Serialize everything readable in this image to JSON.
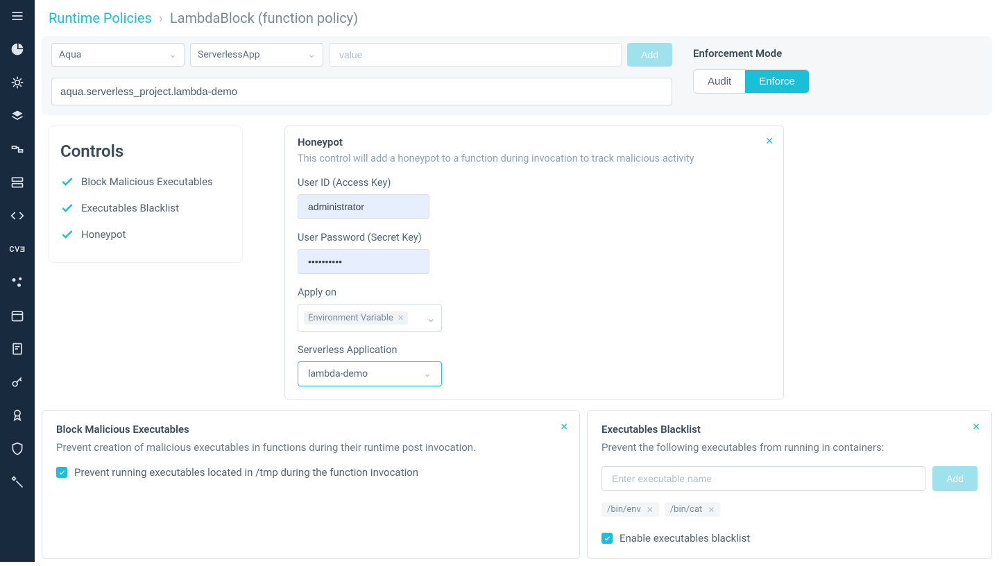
{
  "breadcrumb": {
    "root": "Runtime Policies",
    "current": "LambdaBlock (function policy)"
  },
  "topbar": {
    "select_namespace": "Aqua",
    "select_app": "ServerlessApp",
    "value_placeholder": "value",
    "add_label": "Add",
    "scope_value": "aqua.serverless_project.lambda-demo"
  },
  "enforcement": {
    "title": "Enforcement Mode",
    "options": [
      "Audit",
      "Enforce"
    ],
    "active": "Enforce"
  },
  "controls_panel": {
    "title": "Controls",
    "items": [
      "Block Malicious Executables",
      "Executables Blacklist",
      "Honeypot"
    ]
  },
  "honeypot": {
    "title": "Honeypot",
    "desc": "This control will add a honeypot to a function during invocation to track malicious activity",
    "user_id_label": "User ID (Access Key)",
    "user_id_value": "administrator",
    "password_label": "User Password (Secret Key)",
    "password_value": "••••••••••",
    "apply_on_label": "Apply on",
    "apply_on_chip": "Environment Variable",
    "app_label": "Serverless Application",
    "app_value": "lambda-demo"
  },
  "block_exec": {
    "title": "Block Malicious Executables",
    "desc": "Prevent creation of malicious executables in functions during their runtime post invocation.",
    "option": "Prevent running executables located in /tmp during the function invocation"
  },
  "blacklist": {
    "title": "Executables Blacklist",
    "desc": "Prevent the following executables from running in containers:",
    "input_placeholder": "Enter executable name",
    "add_label": "Add",
    "pills": [
      "/bin/env",
      "/bin/cat"
    ],
    "enable_label": "Enable executables blacklist"
  }
}
